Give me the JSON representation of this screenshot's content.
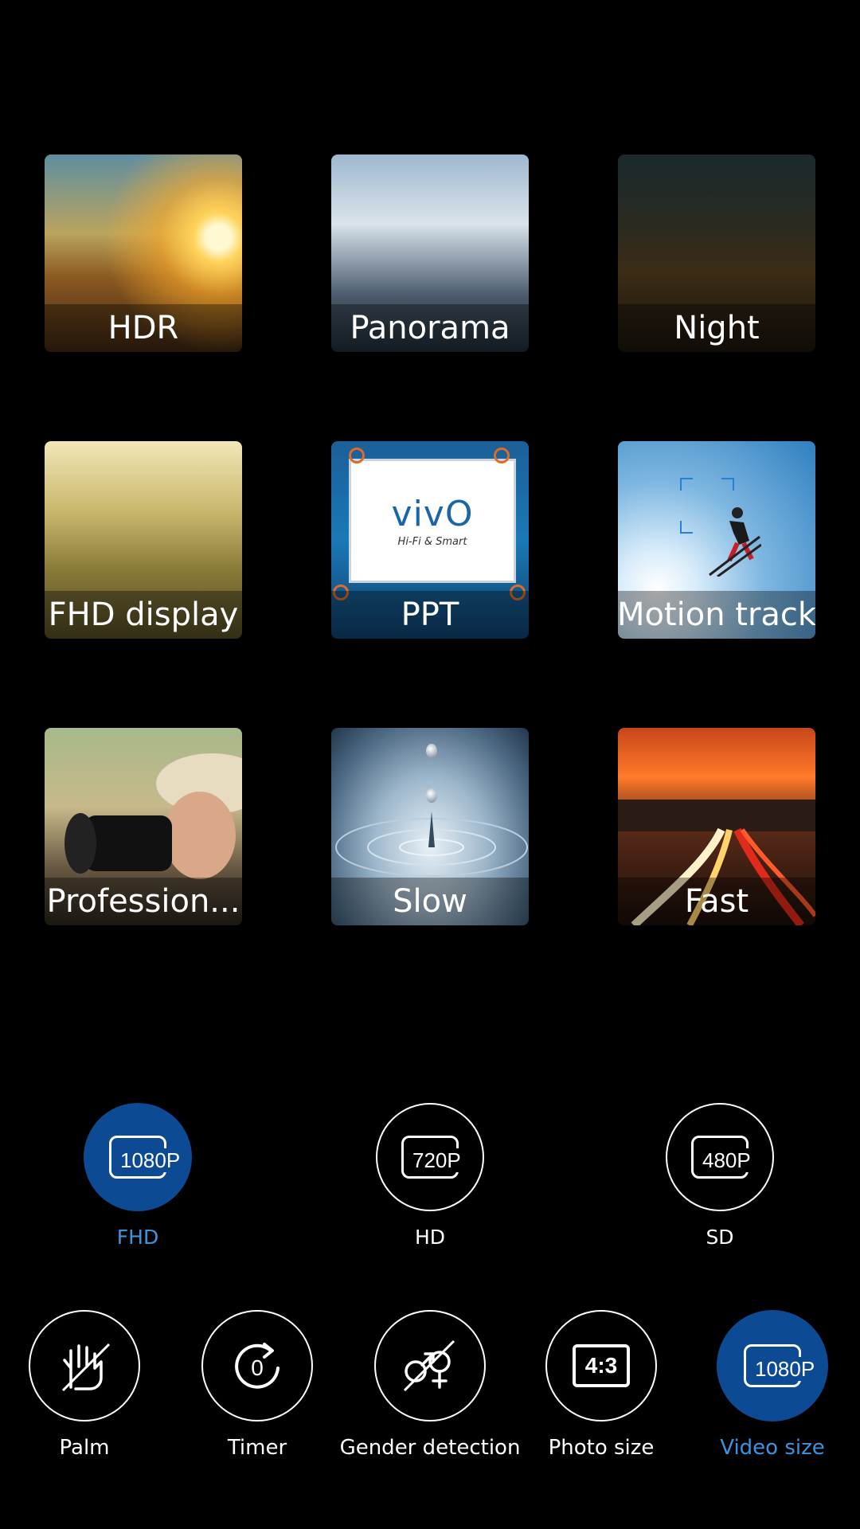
{
  "modes": [
    {
      "label": "HDR"
    },
    {
      "label": "Panorama"
    },
    {
      "label": "Night"
    },
    {
      "label": "FHD display"
    },
    {
      "label": "PPT",
      "logo_text": "vivO",
      "logo_tagline": "Hi-Fi & Smart"
    },
    {
      "label": "Motion track"
    },
    {
      "label": "Profession..."
    },
    {
      "label": "Slow"
    },
    {
      "label": "Fast"
    }
  ],
  "resolution": {
    "options": [
      {
        "label": "FHD",
        "icon_text": "1080P",
        "selected": true
      },
      {
        "label": "HD",
        "icon_text": "720P",
        "selected": false
      },
      {
        "label": "SD",
        "icon_text": "480P",
        "selected": false
      }
    ]
  },
  "toolbar": {
    "items": [
      {
        "label": "Palm",
        "icon": "palm-icon"
      },
      {
        "label": "Timer",
        "icon": "timer-icon",
        "icon_text": "0"
      },
      {
        "label": "Gender detection",
        "icon": "gender-detection-icon"
      },
      {
        "label": "Photo size",
        "icon": "photo-size-icon",
        "icon_text": "4:3"
      },
      {
        "label": "Video size",
        "icon": "video-size-icon",
        "icon_text": "1080P",
        "selected": true
      }
    ]
  },
  "colors": {
    "background": "#000000",
    "accent": "#3a94e0",
    "selected_fill": "#0d4a94"
  }
}
